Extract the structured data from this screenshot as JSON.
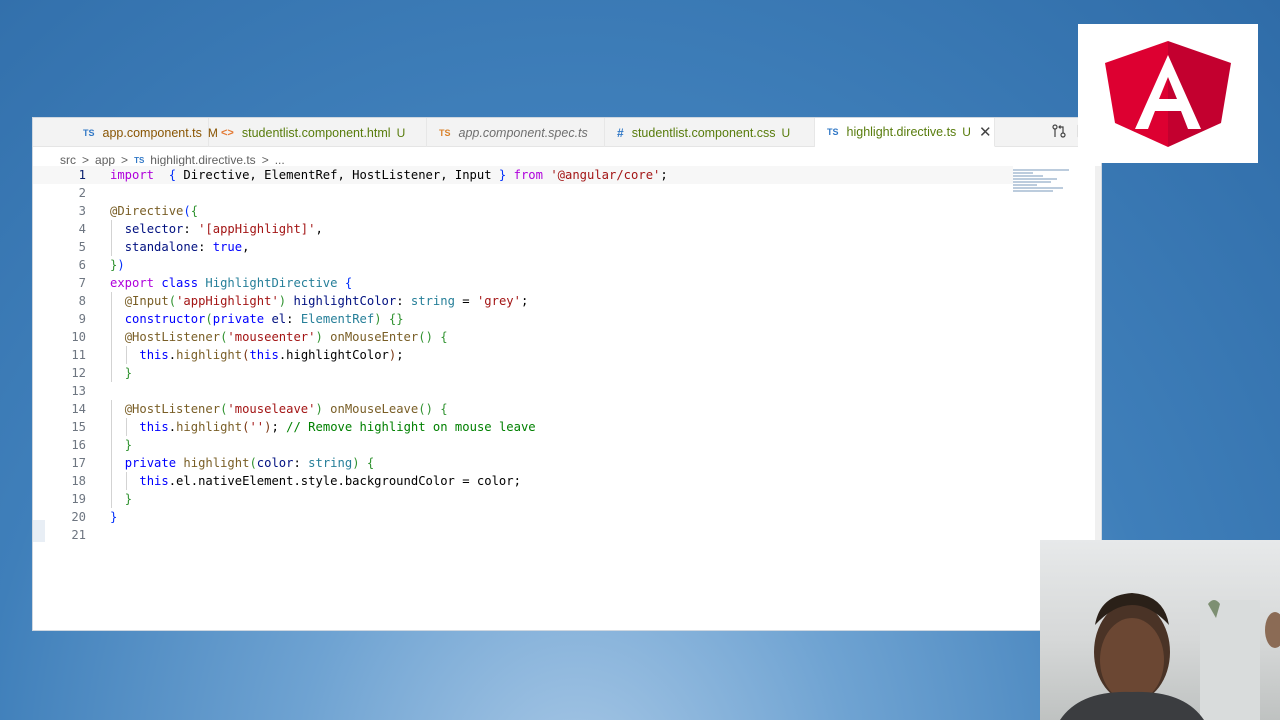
{
  "tabs": [
    {
      "icon": "TS",
      "name": "app.component.ts",
      "status": "M",
      "state": "modified"
    },
    {
      "icon": "<>",
      "name": "studentlist.component.html",
      "status": "U",
      "state": "untracked"
    },
    {
      "icon": "TS",
      "name": "app.component.spec.ts",
      "status": "",
      "state": "preview"
    },
    {
      "icon": "#",
      "name": "studentlist.component.css",
      "status": "U",
      "state": "untracked"
    },
    {
      "icon": "TS",
      "name": "highlight.directive.ts",
      "status": "U",
      "state": "active"
    }
  ],
  "breadcrumb": {
    "parts": [
      "src",
      "app",
      "highlight.directive.ts",
      "..."
    ],
    "sep": ">",
    "ts_icon": "TS"
  },
  "editor_actions": {
    "compare_icon": "compare-changes-icon",
    "split_icon": "split-editor-icon",
    "close_glyph": "✕"
  },
  "code": {
    "current_line": 1,
    "lines": [
      {
        "n": "1",
        "tokens": [
          [
            "kw2",
            "import"
          ],
          [
            "",
            "  "
          ],
          [
            "br1",
            "{"
          ],
          [
            "",
            " Directive, ElementRef, HostListener, Input "
          ],
          [
            "br1",
            "}"
          ],
          [
            "",
            " "
          ],
          [
            "kw2",
            "from"
          ],
          [
            "",
            " "
          ],
          [
            "str",
            "'@angular/core'"
          ],
          [
            "",
            ";"
          ]
        ]
      },
      {
        "n": "2",
        "tokens": []
      },
      {
        "n": "3",
        "tokens": [
          [
            "fn",
            "@Directive"
          ],
          [
            "br1",
            "("
          ],
          [
            "br2",
            "{"
          ]
        ]
      },
      {
        "n": "4",
        "tokens": [
          [
            "",
            "  "
          ],
          [
            "var",
            "selector"
          ],
          [
            "",
            ": "
          ],
          [
            "str",
            "'[appHighlight]'"
          ],
          [
            "",
            ","
          ]
        ]
      },
      {
        "n": "5",
        "tokens": [
          [
            "",
            "  "
          ],
          [
            "var",
            "standalone"
          ],
          [
            "",
            ": "
          ],
          [
            "kw",
            "true"
          ],
          [
            "",
            ","
          ]
        ]
      },
      {
        "n": "6",
        "tokens": [
          [
            "br2",
            "}"
          ],
          [
            "br1",
            ")"
          ]
        ]
      },
      {
        "n": "7",
        "tokens": [
          [
            "kw2",
            "export"
          ],
          [
            "",
            " "
          ],
          [
            "kw",
            "class"
          ],
          [
            "",
            " "
          ],
          [
            "cls",
            "HighlightDirective"
          ],
          [
            "",
            " "
          ],
          [
            "br1",
            "{"
          ]
        ]
      },
      {
        "n": "8",
        "tokens": [
          [
            "",
            "  "
          ],
          [
            "fn",
            "@Input"
          ],
          [
            "br2",
            "("
          ],
          [
            "str",
            "'appHighlight'"
          ],
          [
            "br2",
            ")"
          ],
          [
            "",
            " "
          ],
          [
            "var",
            "highlightColor"
          ],
          [
            "",
            ": "
          ],
          [
            "cls",
            "string"
          ],
          [
            "",
            " = "
          ],
          [
            "str",
            "'grey'"
          ],
          [
            "",
            ";"
          ]
        ]
      },
      {
        "n": "9",
        "tokens": [
          [
            "",
            "  "
          ],
          [
            "kw",
            "constructor"
          ],
          [
            "br2",
            "("
          ],
          [
            "kw",
            "private"
          ],
          [
            "",
            " "
          ],
          [
            "var",
            "el"
          ],
          [
            "",
            ": "
          ],
          [
            "cls",
            "ElementRef"
          ],
          [
            "br2",
            ")"
          ],
          [
            "",
            " "
          ],
          [
            "br2",
            "{}"
          ]
        ]
      },
      {
        "n": "10",
        "tokens": [
          [
            "",
            "  "
          ],
          [
            "fn",
            "@HostListener"
          ],
          [
            "br2",
            "("
          ],
          [
            "str",
            "'mouseenter'"
          ],
          [
            "br2",
            ")"
          ],
          [
            "",
            " "
          ],
          [
            "fn",
            "onMouseEnter"
          ],
          [
            "br2",
            "()"
          ],
          [
            "",
            " "
          ],
          [
            "br2",
            "{"
          ]
        ]
      },
      {
        "n": "11",
        "tokens": [
          [
            "",
            "    "
          ],
          [
            "kw",
            "this"
          ],
          [
            "",
            "."
          ],
          [
            "fn",
            "highlight"
          ],
          [
            "br3",
            "("
          ],
          [
            "kw",
            "this"
          ],
          [
            "",
            ".highlightColor"
          ],
          [
            "br3",
            ")"
          ],
          [
            "",
            ";"
          ]
        ]
      },
      {
        "n": "12",
        "tokens": [
          [
            "",
            "  "
          ],
          [
            "br2",
            "}"
          ]
        ]
      },
      {
        "n": "13",
        "tokens": []
      },
      {
        "n": "14",
        "tokens": [
          [
            "",
            "  "
          ],
          [
            "fn",
            "@HostListener"
          ],
          [
            "br2",
            "("
          ],
          [
            "str",
            "'mouseleave'"
          ],
          [
            "br2",
            ")"
          ],
          [
            "",
            " "
          ],
          [
            "fn",
            "onMouseLeave"
          ],
          [
            "br2",
            "()"
          ],
          [
            "",
            " "
          ],
          [
            "br2",
            "{"
          ]
        ]
      },
      {
        "n": "15",
        "tokens": [
          [
            "",
            "    "
          ],
          [
            "kw",
            "this"
          ],
          [
            "",
            "."
          ],
          [
            "fn",
            "highlight"
          ],
          [
            "br3",
            "("
          ],
          [
            "str",
            "''"
          ],
          [
            "br3",
            ")"
          ],
          [
            "",
            "; "
          ],
          [
            "cm",
            "// Remove highlight on mouse leave"
          ]
        ]
      },
      {
        "n": "16",
        "tokens": [
          [
            "",
            "  "
          ],
          [
            "br2",
            "}"
          ]
        ]
      },
      {
        "n": "17",
        "tokens": [
          [
            "",
            "  "
          ],
          [
            "kw",
            "private"
          ],
          [
            "",
            " "
          ],
          [
            "fn",
            "highlight"
          ],
          [
            "br2",
            "("
          ],
          [
            "var",
            "color"
          ],
          [
            "",
            ": "
          ],
          [
            "cls",
            "string"
          ],
          [
            "br2",
            ")"
          ],
          [
            "",
            " "
          ],
          [
            "br2",
            "{"
          ]
        ]
      },
      {
        "n": "18",
        "tokens": [
          [
            "",
            "    "
          ],
          [
            "kw",
            "this"
          ],
          [
            "",
            ".el.nativeElement.style.backgroundColor = color;"
          ]
        ]
      },
      {
        "n": "19",
        "tokens": [
          [
            "",
            "  "
          ],
          [
            "br2",
            "}"
          ]
        ]
      },
      {
        "n": "20",
        "tokens": [
          [
            "br1",
            "}"
          ]
        ]
      },
      {
        "n": "21",
        "tokens": []
      }
    ]
  },
  "logo": {
    "name": "angular-logo",
    "letter": "A",
    "red": "#dd0031",
    "dark_red": "#c3002f"
  },
  "webcam": {
    "name": "webcam-presenter"
  }
}
